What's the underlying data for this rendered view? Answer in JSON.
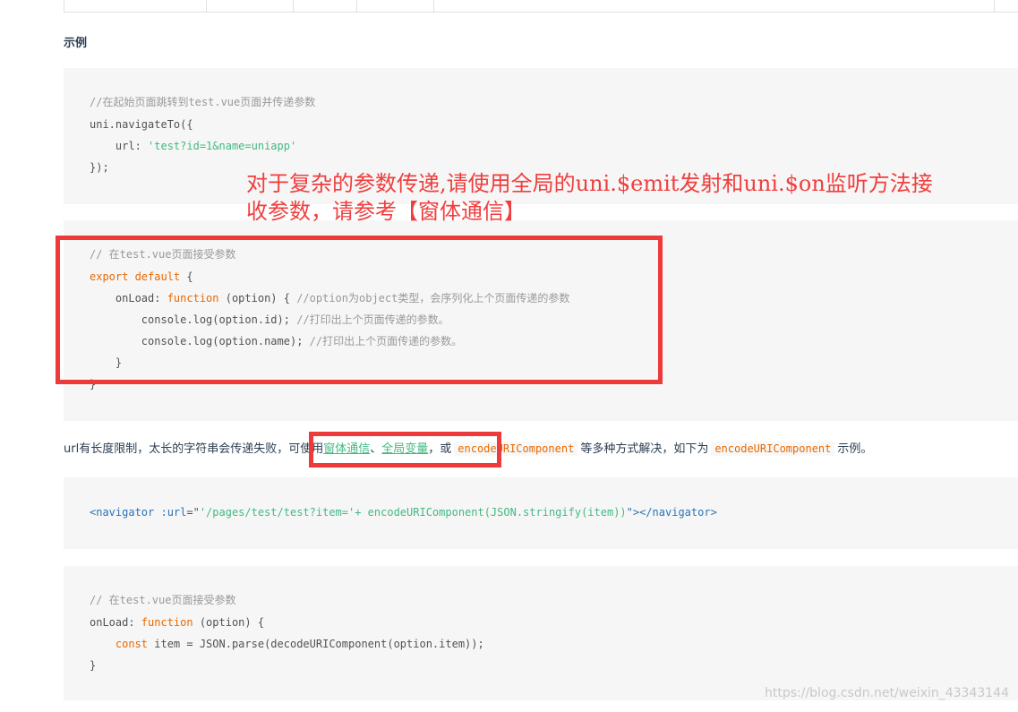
{
  "section_title": "示例",
  "code_block_1": {
    "comment": "//在起始页面跳转到test.vue页面并传递参数",
    "line2": "uni.navigateTo({",
    "url_key": "    url: ",
    "url_value": "'test?id=1&name=uniapp'",
    "line4": "});"
  },
  "annotation": {
    "line1": "对于复杂的参数传递,请使用全局的uni.$emit发射和uni.$on监听方法接",
    "line2": "收参数，请参考【窗体通信】"
  },
  "code_block_2": {
    "comment": "// 在test.vue页面接受参数",
    "export_kw": "export default",
    "export_rest": " {",
    "onload_key": "    onLoad: ",
    "function_kw": "function",
    "onload_rest": " (option) { ",
    "onload_comment": "//option为object类型，会序列化上个页面传递的参数",
    "log_id": "        console.log(option.id); ",
    "log_id_comment": "//打印出上个页面传递的参数。",
    "log_name": "        console.log(option.name); ",
    "log_name_comment": "//打印出上个页面传递的参数。",
    "close_inner": "    }",
    "close_outer": "}"
  },
  "paragraph": {
    "text1": "url有长度限制，太长的字符串会传递失败，可使用",
    "link1": "窗体通信",
    "sep": "、",
    "link2": "全局变量",
    "text2": "，或",
    "code1": "encodeURIComponent",
    "text3": "等多种方式解决，如下为",
    "code2": "encodeURIComponent",
    "text4": "示例。"
  },
  "code_block_3": {
    "open_tag": "<navigator",
    "attr": " :url",
    "eq": "=\"",
    "value": "'/pages/test/test?item='+ encodeURIComponent(JSON.stringify(item))",
    "close": "\"></navigator>"
  },
  "code_block_4": {
    "comment": "// 在test.vue页面接受参数",
    "onload_key": "onLoad: ",
    "function_kw": "function",
    "onload_rest": " (option) {",
    "const_kw": "    const",
    "const_rest": " item = JSON.parse(decodeURIComponent(option.item));",
    "close": "}"
  },
  "watermark": "https://blog.csdn.net/weixin_43343144",
  "colors": {
    "annotation_red": "#f03e3e",
    "box_red": "#ee3a3a",
    "string_green": "#42b983",
    "keyword_orange": "#e96900"
  }
}
